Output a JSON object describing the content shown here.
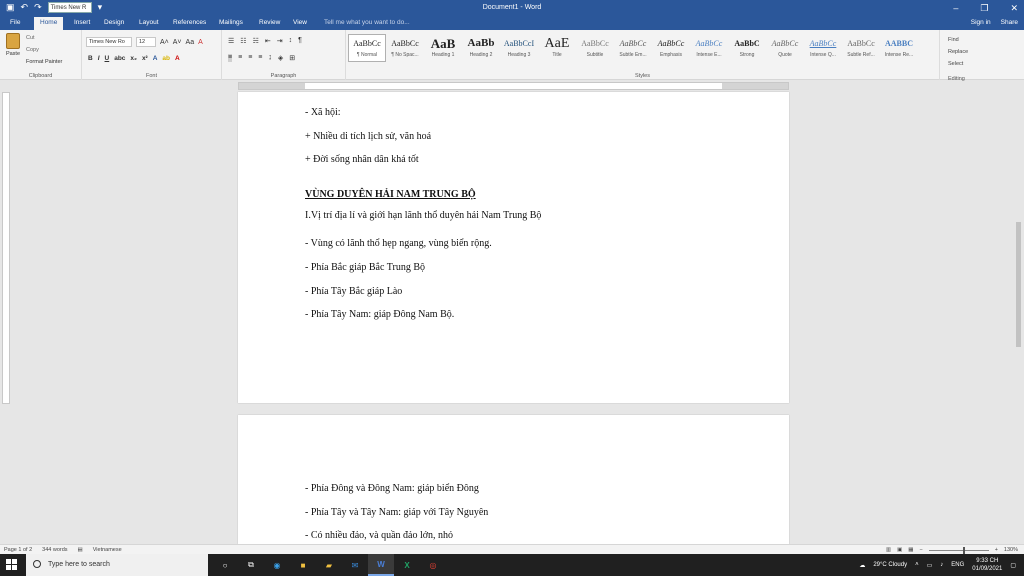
{
  "title": {
    "doc": "Document1 - Word",
    "font": "Times New R",
    "minimize": "–",
    "restore": "❐",
    "close": "✕"
  },
  "tabs": [
    "File",
    "Home",
    "Insert",
    "Design",
    "Layout",
    "References",
    "Mailings",
    "Review",
    "View"
  ],
  "tell": "Tell me what you want to do...",
  "signin": "Sign in",
  "share": "Share",
  "clipboard": {
    "paste": "Paste",
    "cut": "Cut",
    "copy": "Copy",
    "painter": "Format Painter",
    "label": "Clipboard"
  },
  "font": {
    "name": "Times New Ro",
    "size": "12",
    "label": "Font",
    "bold": "B",
    "italic": "I",
    "underline": "U"
  },
  "paragraph": {
    "label": "Paragraph"
  },
  "styles": {
    "label": "Styles",
    "items": [
      {
        "preview": "AaBbCc",
        "name": "¶ Normal"
      },
      {
        "preview": "AaBbCc",
        "name": "¶ No Spac..."
      },
      {
        "preview": "AaB",
        "name": "Heading 1"
      },
      {
        "preview": "AaBb",
        "name": "Heading 2"
      },
      {
        "preview": "AaBbCcI",
        "name": "Heading 3"
      },
      {
        "preview": "AaE",
        "name": "Title"
      },
      {
        "preview": "AaBbCc",
        "name": "Subtitle"
      },
      {
        "preview": "AaBbCc",
        "name": "Subtle Em..."
      },
      {
        "preview": "AaBbCc",
        "name": "Emphasis"
      },
      {
        "preview": "AaBbCc",
        "name": "Intense E..."
      },
      {
        "preview": "AaBbC",
        "name": "Strong"
      },
      {
        "preview": "AaBbCc",
        "name": "Quote"
      },
      {
        "preview": "AaBbCc",
        "name": "Intense Q..."
      },
      {
        "preview": "AaBbCc",
        "name": "Subtle Ref..."
      },
      {
        "preview": "AABBC",
        "name": "Intense Re..."
      }
    ]
  },
  "editing": {
    "find": "Find",
    "replace": "Replace",
    "select": "Select",
    "label": "Editing"
  },
  "page1": [
    "- Xã hội:",
    "+ Nhiều di tích lịch sử, văn hoá",
    "+ Đời sống nhân dân khá tốt",
    "VÙNG DUYÊN HẢI NAM TRUNG BỘ",
    "I.Vị trí địa lí và giới hạn lãnh thổ duyên hải Nam Trung Bộ",
    "- Vùng có lãnh thổ hẹp ngang, vùng biển rộng.",
    "- Phía Bắc giáp Bắc Trung Bộ",
    "- Phía Tây Bắc giáp Lào",
    "- Phía Tây Nam: giáp Đông Nam Bộ."
  ],
  "page2": [
    "- Phía Đông và Đông Nam: giáp biển Đông",
    "- Phía Tây và Tây Nam: giáp với Tây Nguyên",
    "- Có nhiều đảo, và quần đảo lớn, nhỏ"
  ],
  "status": {
    "page": "Page 1 of 2",
    "words": "344 words",
    "lang": "Vietnamese",
    "zoom": "130%"
  },
  "taskbar": {
    "search": "Type here to search",
    "weather": "29°C Cloudy",
    "lang": "ENG",
    "time": "9:33 CH",
    "date": "01/09/2021"
  }
}
